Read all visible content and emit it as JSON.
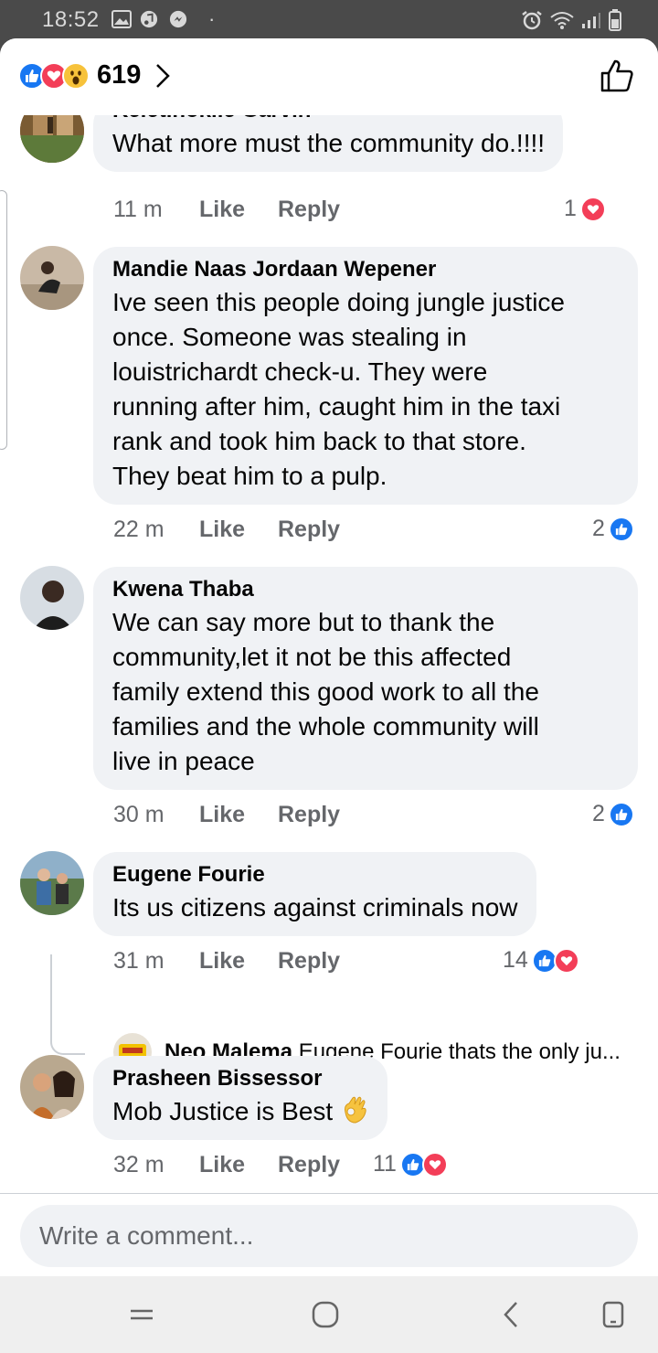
{
  "status_bar": {
    "time": "18:52"
  },
  "header": {
    "reaction_count": "619"
  },
  "comments": [
    {
      "name": "Keletlhokile Garvin",
      "text": "What more must the community do.!!!!",
      "time": "11 m",
      "like": "Like",
      "reply": "Reply",
      "reactions": "1"
    },
    {
      "name": "Mandie Naas Jordaan Wepener",
      "text": "Ive seen this people doing jungle justice\nonce. Someone was stealing in\nlouistrichardt check-u. They were\nrunning after him, caught him in the taxi\nrank and took him back to that store.\nThey beat him to a pulp.",
      "time": "22 m",
      "like": "Like",
      "reply": "Reply",
      "reactions": "2"
    },
    {
      "name": "Kwena Thaba",
      "text": "We can say more but to thank the\ncommunity,let it not be this affected\nfamily extend this good work to all the\nfamilies and the whole community will\nlive in peace",
      "time": "30 m",
      "like": "Like",
      "reply": "Reply",
      "reactions": "2"
    },
    {
      "name": "Eugene Fourie",
      "text": "Its us citizens against criminals now",
      "time": "31 m",
      "like": "Like",
      "reply": "Reply",
      "reactions": "14"
    },
    {
      "name": "Prasheen Bissessor",
      "text": "Mob Justice is Best",
      "time": "32 m",
      "like": "Like",
      "reply": "Reply",
      "reactions": "11"
    }
  ],
  "reply_preview": {
    "name": "Neo Malema",
    "text": "Eugene Fourie thats the only ju..."
  },
  "composer": {
    "placeholder": "Write a comment..."
  },
  "colors": {
    "like_blue": "#1877f2",
    "love_red": "#f33e58",
    "bubble_bg": "#f0f2f5",
    "meta_gray": "#65676b"
  },
  "icons": [
    "gallery-icon",
    "music-icon",
    "messenger-icon",
    "alarm-icon",
    "wifi-icon",
    "signal-icon",
    "battery-icon",
    "like-reaction-icon",
    "love-reaction-icon",
    "wow-reaction-icon",
    "chevron-right-icon",
    "thumbs-up-icon",
    "ok-hand-emoji",
    "menu-nav-icon",
    "home-nav-icon",
    "back-nav-icon",
    "recents-nav-icon"
  ]
}
